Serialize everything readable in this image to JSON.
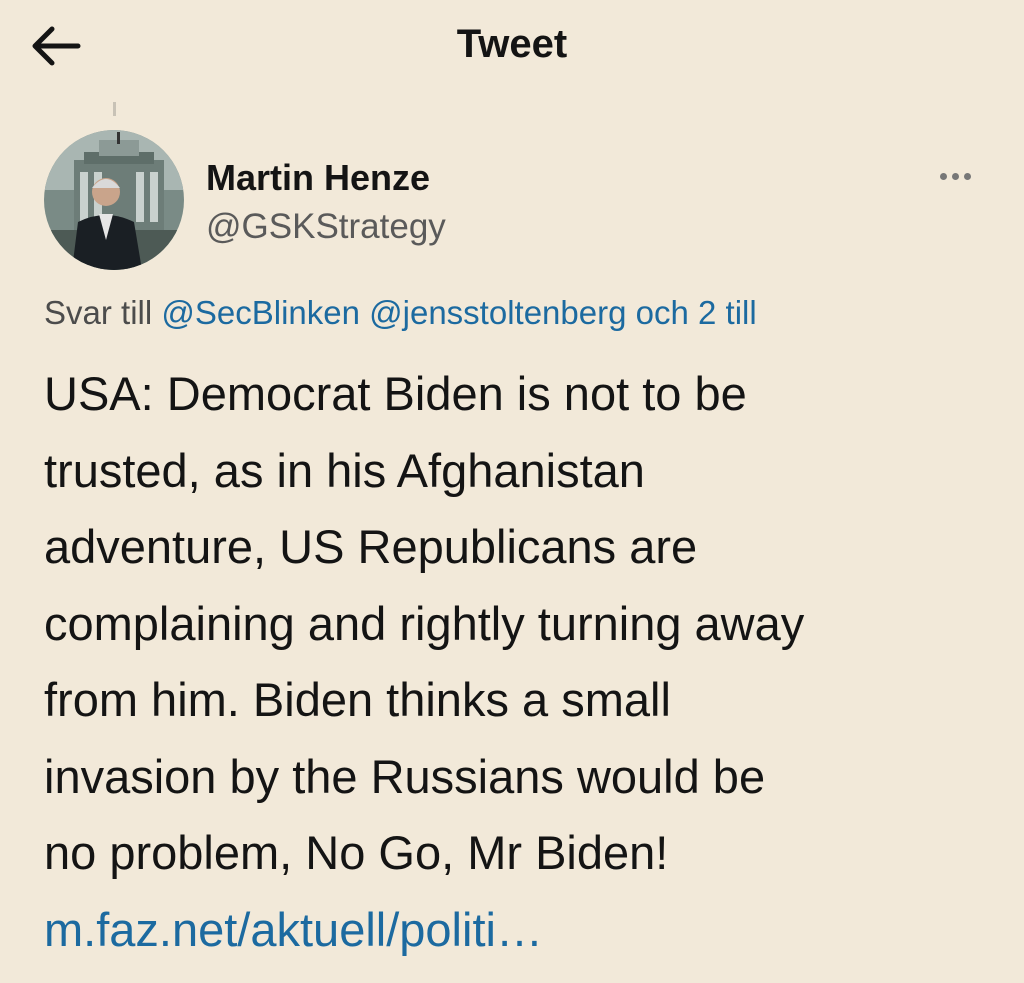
{
  "header": {
    "title": "Tweet"
  },
  "author": {
    "name": "Martin Henze",
    "handle": "@GSKStrategy"
  },
  "reply": {
    "prefix": "Svar till",
    "mentions": [
      "@SecBlinken",
      "@jensstoltenberg"
    ],
    "suffix": "och 2 till"
  },
  "tweet": {
    "lines": [
      "USA: Democrat Biden is not to be",
      "trusted, as in his Afghanistan",
      "adventure, US Republicans are",
      "complaining and rightly turning away",
      "from him. Biden thinks a small",
      "invasion by the Russians would be",
      "no problem, No Go, Mr Biden!"
    ],
    "link": "m.faz.net/aktuell/politi…"
  },
  "colors": {
    "background": "#f2e9d9",
    "link": "#1c6aa0",
    "text": "#141414",
    "secondary": "#5a5a5a"
  },
  "icons": {
    "back": "arrow-left-icon",
    "more": "more-horizontal-icon"
  }
}
